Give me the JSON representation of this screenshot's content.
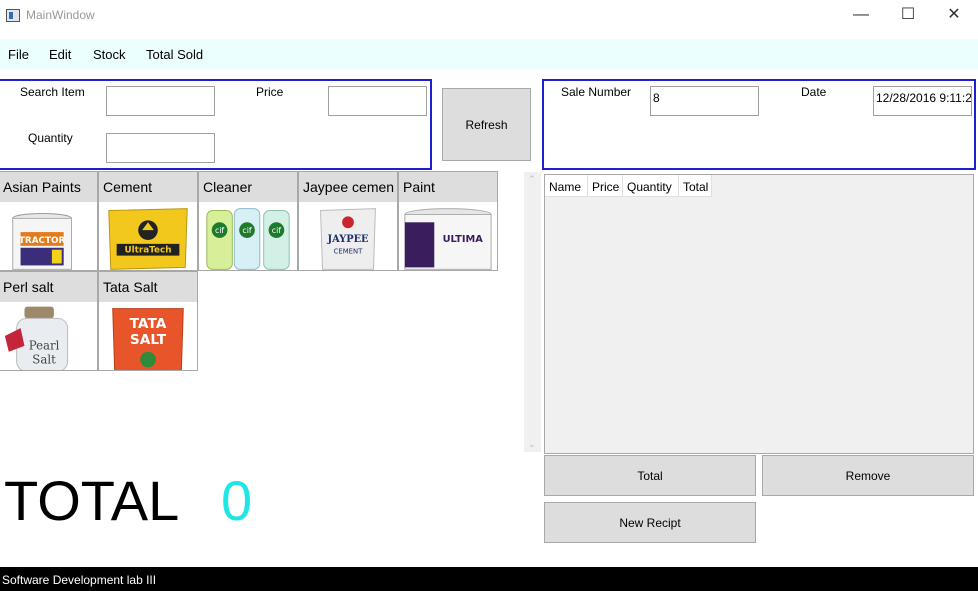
{
  "window": {
    "title": "MainWindow",
    "minimize_glyph": "—",
    "maximize_glyph": "☐",
    "close_glyph": "✕"
  },
  "menu": {
    "items": [
      "File",
      "Edit",
      "Stock",
      "Total Sold"
    ]
  },
  "search_panel": {
    "search_label": "Search Item",
    "search_value": "",
    "price_label": "Price",
    "price_value": "",
    "quantity_label": "Quantity",
    "quantity_value": ""
  },
  "refresh_button": "Refresh",
  "sale_panel": {
    "sale_number_label": "Sale Number",
    "sale_number_value": "8",
    "date_label": "Date",
    "date_value": "12/28/2016 9:11:2"
  },
  "products": [
    {
      "name": "Asian Paints",
      "icon": "paint-bucket-tractor"
    },
    {
      "name": "Cement",
      "icon": "cement-bag-ultratech"
    },
    {
      "name": "Cleaner",
      "icon": "cif-cleaner-bottles"
    },
    {
      "name": "Jaypee cemen",
      "icon": "cement-bag-jaypee"
    },
    {
      "name": "Paint",
      "icon": "paint-bucket-ultima"
    },
    {
      "name": "Perl salt",
      "icon": "salt-jar"
    },
    {
      "name": "Tata Salt",
      "icon": "salt-packet"
    }
  ],
  "sales_grid": {
    "columns": [
      "Name",
      "Price",
      "Quantity",
      "Total"
    ],
    "rows": []
  },
  "buttons": {
    "total": "Total",
    "remove": "Remove",
    "new_receipt": "New Recipt"
  },
  "total_display": {
    "label": "TOTAL",
    "value": "0"
  },
  "status_bar": "Software Development lab III",
  "colors": {
    "menu_bg": "#eafffe",
    "panel_border": "#1f1fd0",
    "total_value": "#1fe6e6",
    "status_bg": "#000000"
  }
}
